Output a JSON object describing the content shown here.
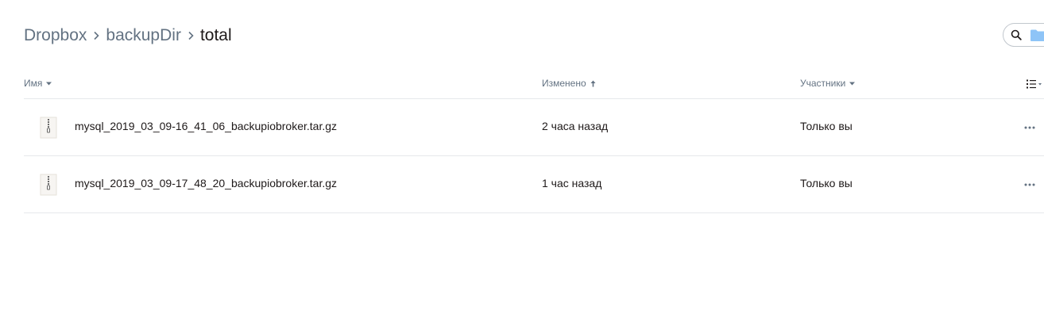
{
  "breadcrumb": {
    "items": [
      {
        "label": "Dropbox"
      },
      {
        "label": "backupDir"
      },
      {
        "label": "total"
      }
    ]
  },
  "columns": {
    "name": "Имя",
    "modified": "Изменено",
    "members": "Участники"
  },
  "files": [
    {
      "name": "mysql_2019_03_09-16_41_06_backupiobroker.tar.gz",
      "modified": "2 часа назад",
      "members": "Только вы",
      "icon": "zip-archive-icon"
    },
    {
      "name": "mysql_2019_03_09-17_48_20_backupiobroker.tar.gz",
      "modified": "1 час назад",
      "members": "Только вы",
      "icon": "zip-archive-icon"
    }
  ],
  "colors": {
    "breadcrumb_parent": "#637282",
    "breadcrumb_current": "#1e1919",
    "text": "#1e1919",
    "muted": "#637282",
    "divider": "#e6e8eb",
    "folder_blue": "#8ec4f7"
  }
}
